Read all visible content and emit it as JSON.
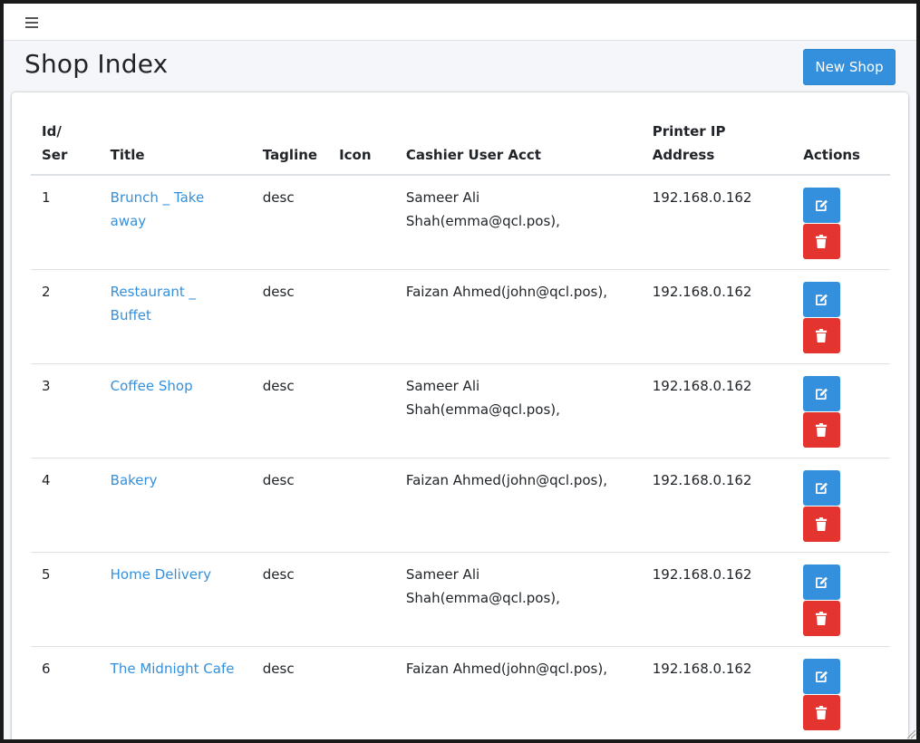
{
  "header": {
    "menu_icon": "hamburger-menu-icon"
  },
  "page": {
    "title": "Shop Index",
    "new_shop_label": "New Shop"
  },
  "table": {
    "columns": {
      "id": [
        "Id/",
        "Ser"
      ],
      "title": "Title",
      "tagline": "Tagline",
      "icon": "Icon",
      "cashier": "Cashier User Acct",
      "printer": [
        "Printer IP",
        "Address"
      ],
      "actions": "Actions"
    },
    "rows": [
      {
        "id": "1",
        "title": "Brunch _ Take away",
        "tagline": "desc",
        "icon": "",
        "cashier": "Sameer Ali Shah(emma@qcl.pos),",
        "printer": "192.168.0.162"
      },
      {
        "id": "2",
        "title": "Restaurant _ Buffet",
        "tagline": "desc",
        "icon": "",
        "cashier": "Faizan Ahmed(john@qcl.pos),",
        "printer": "192.168.0.162"
      },
      {
        "id": "3",
        "title": "Coffee Shop",
        "tagline": "desc",
        "icon": "",
        "cashier": "Sameer Ali Shah(emma@qcl.pos),",
        "printer": "192.168.0.162"
      },
      {
        "id": "4",
        "title": "Bakery",
        "tagline": "desc",
        "icon": "",
        "cashier": "Faizan Ahmed(john@qcl.pos),",
        "printer": "192.168.0.162"
      },
      {
        "id": "5",
        "title": "Home Delivery",
        "tagline": "desc",
        "icon": "",
        "cashier": "Sameer Ali Shah(emma@qcl.pos),",
        "printer": "192.168.0.162"
      },
      {
        "id": "6",
        "title": "The Midnight Cafe",
        "tagline": "desc",
        "icon": "",
        "cashier": "Faizan Ahmed(john@qcl.pos),",
        "printer": "192.168.0.162"
      }
    ]
  },
  "colors": {
    "primary": "#3490dc",
    "danger": "#e3342f",
    "background": "#f4f6f9"
  },
  "icons": {
    "edit": "edit-icon",
    "delete": "trash-icon"
  }
}
